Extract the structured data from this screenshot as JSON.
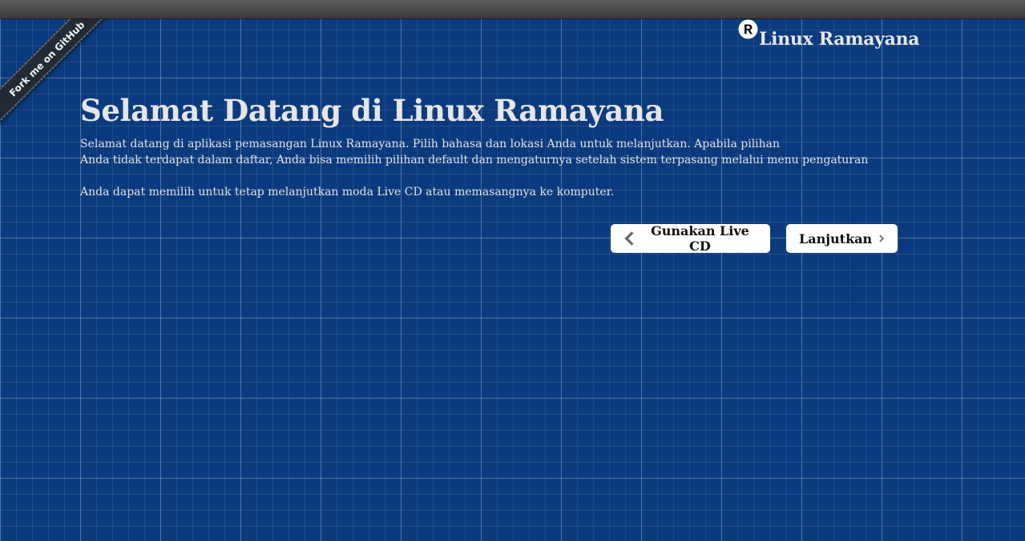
{
  "window": {
    "topbar": ""
  },
  "ribbon": {
    "label": "Fork me on GitHub"
  },
  "brand": {
    "logo_icon": "registered-r-icon",
    "name": "Linux Ramayana"
  },
  "main": {
    "title": "Selamat Datang di Linux Ramayana",
    "paragraph_1_line_1": "Selamat datang di aplikasi pemasangan Linux Ramayana. Pilih bahasa dan lokasi Anda untuk melanjutkan. Apabila pilihan",
    "paragraph_1_line_2": "Anda tidak terdapat dalam daftar, Anda bisa memilih pilihan default dan mengaturnya setelah sistem terpasang melalui menu pengaturan",
    "paragraph_2": "Anda dapat memilih untuk tetap melanjutkan moda Live CD atau memasangnya ke komputer."
  },
  "actions": {
    "live_cd_label": "Gunakan Live CD",
    "live_cd_icon": "chevron-left-icon",
    "next_label": "Lanjutkan",
    "next_icon": "chevron-right-icon"
  },
  "colors": {
    "background": "#0b3b7e",
    "text": "#e6e6e6",
    "button_bg": "#ffffff",
    "chevron": "#6b6b6b",
    "topbar": "#4a4948",
    "ribbon": "#222a35"
  }
}
